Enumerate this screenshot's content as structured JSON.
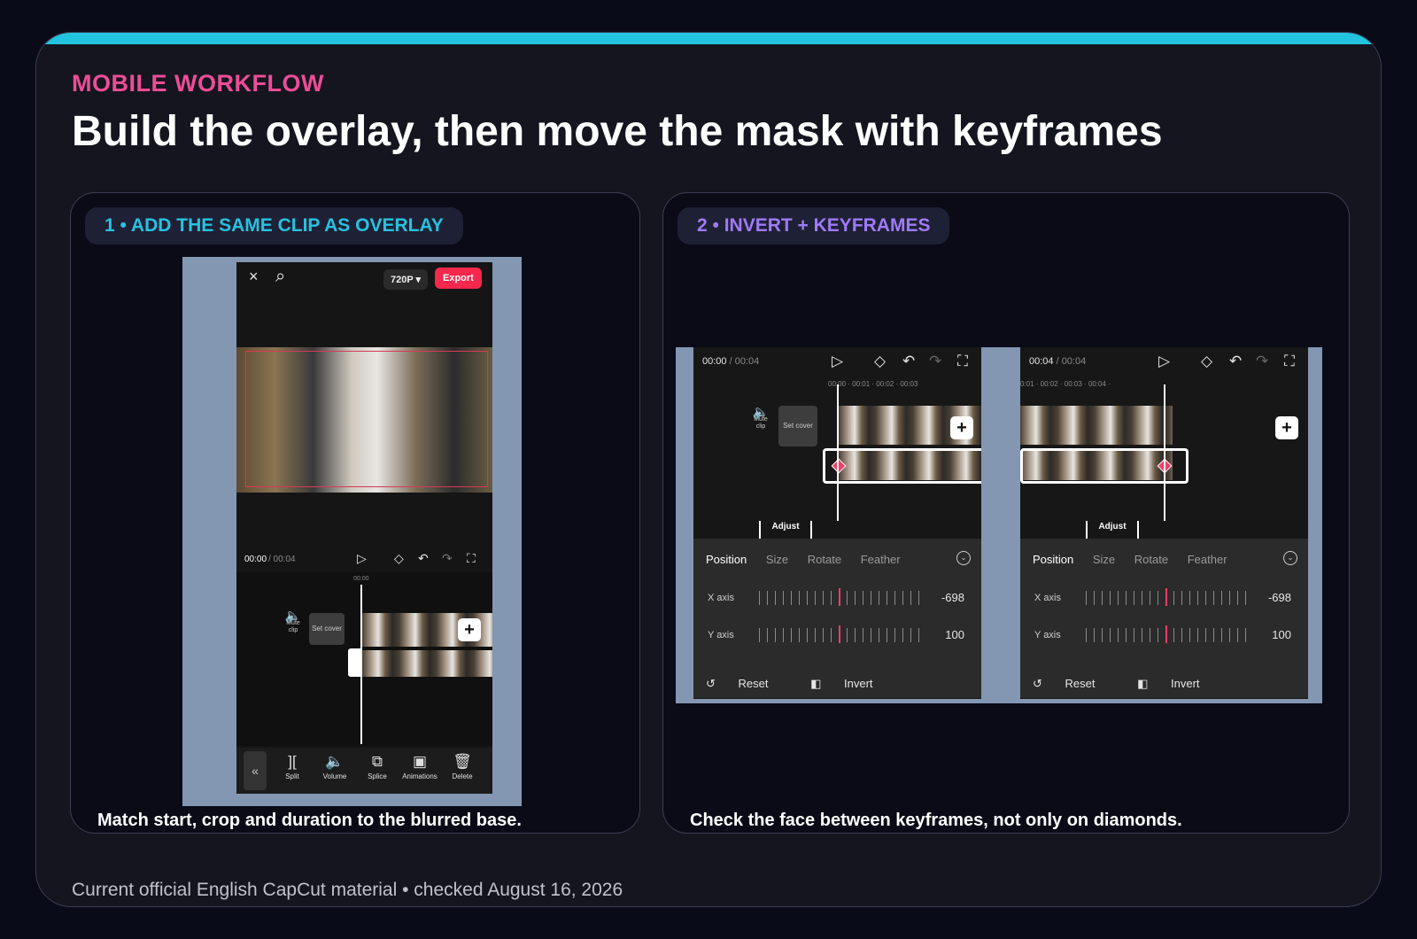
{
  "kicker": "MOBILE WORKFLOW",
  "headline": "Build the overlay, then move the mask with keyframes",
  "colors": {
    "accent_cyan": "#22c3df",
    "accent_pink": "#ec4d97",
    "accent_purple": "#a07af7",
    "export_red": "#f5284d",
    "keyframe_red": "#ef3f6a"
  },
  "panel1": {
    "title": "1 • ADD THE SAME CLIP AS OVERLAY",
    "caption": "Match start, crop and duration to the blurred base.",
    "phone": {
      "close_icon": "×",
      "search_icon": "⌕",
      "resolution": "720P ▾",
      "export_label": "Export",
      "time_current": "00:00",
      "time_total": " / 00:04",
      "ruler_label": "00:00",
      "mute_label": "Mute clip",
      "set_cover": "Set cover",
      "plus": "+",
      "back": "«",
      "tools": [
        {
          "glyph": "][",
          "label": "Split"
        },
        {
          "glyph": "🔈",
          "label": "Volume"
        },
        {
          "glyph": "⧉",
          "label": "Splice"
        },
        {
          "glyph": "▣",
          "label": "Animations"
        },
        {
          "glyph": "🗑",
          "label": "Delete"
        }
      ]
    }
  },
  "panel2": {
    "title": "2 • INVERT + KEYFRAMES",
    "caption": "Check the face between keyframes, not only on diamonds.",
    "screens": [
      {
        "time_current": "00:00",
        "time_total": " / 00:04",
        "ruler": "00:00  ·  00:01  ·  00:02  ·  00:03",
        "tabs": [
          "Position",
          "Size",
          "Rotate",
          "Feather"
        ],
        "x_label": "X axis",
        "x_value": "-698",
        "y_label": "Y axis",
        "y_value": "100",
        "reset": "Reset",
        "invert": "Invert",
        "adjust": "Adjust",
        "mute_label": "Mute clip",
        "set_cover": "Set cover",
        "plus": "+"
      },
      {
        "time_current": "00:04",
        "time_total": " / 00:04",
        "ruler": "0:01  ·  00:02  ·  00:03  ·  00:04  ·",
        "tabs": [
          "Position",
          "Size",
          "Rotate",
          "Feather"
        ],
        "x_label": "X axis",
        "x_value": "-698",
        "y_label": "Y axis",
        "y_value": "100",
        "reset": "Reset",
        "invert": "Invert",
        "adjust": "Adjust",
        "plus": "+"
      }
    ]
  },
  "footer": "Current official English CapCut material • checked August 16, 2026"
}
